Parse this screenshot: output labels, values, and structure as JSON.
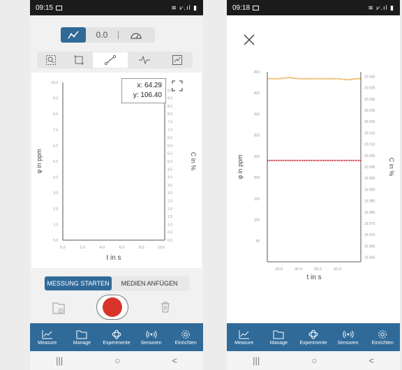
{
  "colors": {
    "accent": "#2f6a99",
    "record": "#d9342b",
    "series_orange": "#e39d2c",
    "series_red": "#c8232c"
  },
  "left": {
    "status": {
      "time": "09:15",
      "icons": "≋ ⩗.ıl ▮"
    },
    "mode_bar": {
      "graph_icon": "graph-icon",
      "value_label": "0.0",
      "gauge_icon": "gauge-icon"
    },
    "toolbar": [
      "zoom-box-icon",
      "crop-icon",
      "line-tool-icon",
      "smoothing-icon",
      "fit-icon"
    ],
    "chart_data": {
      "type": "line",
      "xlabel": "t in s",
      "ylabel": "φ in ppm",
      "y2label": "C in %",
      "xlim": [
        0,
        100
      ],
      "ylim": [
        0,
        10
      ],
      "y2lim": [
        0,
        10
      ],
      "xticks": [
        "0.0",
        "2.0",
        "4.0",
        "6.0",
        "8.0",
        "10.0"
      ],
      "yticks": [
        "0.0",
        "1.0",
        "2.0",
        "3.0",
        "4.0",
        "5.0",
        "6.0",
        "7.0",
        "8.0",
        "9.0",
        "10.0"
      ],
      "y2ticks": [
        "0.0",
        "0.5",
        "1.0",
        "1.5",
        "2.0",
        "2.5",
        "3.0",
        "3.5",
        "4.0",
        "4.5",
        "5.0",
        "5.5",
        "6.0",
        "6.5",
        "7.0",
        "7.5",
        "8.0",
        "8.5",
        "9.0",
        "9.5"
      ],
      "series": [],
      "grid": false
    },
    "readout": {
      "x": "x: 64.29",
      "y": "y: 106.40"
    },
    "buttons": {
      "start": "MESSUNG STARTEN",
      "media": "MEDIEN ANFÜGEN"
    }
  },
  "right": {
    "status": {
      "time": "09:18",
      "icons": "≋ ⩗.ıl ▮"
    },
    "chart_data": {
      "type": "line",
      "xlabel": "t in s",
      "ylabel": "φ in ppm",
      "y2label": "C in %",
      "xlim": [
        24,
        72
      ],
      "ylim": [
        0,
        450
      ],
      "y2lim": [
        19.958,
        20.042
      ],
      "xticks": [
        "30.0",
        "40.0",
        "50.0",
        "60.0"
      ],
      "xtick_values": [
        30,
        40,
        50,
        60
      ],
      "yticks": [
        "50",
        "100",
        "150",
        "200",
        "250",
        "300",
        "350",
        "400",
        "450"
      ],
      "y2ticks": [
        "19.960",
        "19.965",
        "19.970",
        "19.975",
        "19.980",
        "19.985",
        "19.990",
        "19.995",
        "20.000",
        "20.005",
        "20.010",
        "20.015",
        "20.020",
        "20.025",
        "20.030",
        "20.035",
        "20.040"
      ],
      "series": [
        {
          "axis": "y2",
          "x": [
            24,
            30,
            35,
            40,
            45,
            50,
            55,
            60,
            65,
            70,
            72
          ],
          "values": [
            20.039,
            20.039,
            20.0395,
            20.039,
            20.039,
            20.039,
            20.039,
            20.039,
            20.0385,
            20.039,
            20.039
          ]
        },
        {
          "axis": "y",
          "x": [
            24,
            30,
            35,
            40,
            45,
            50,
            55,
            60,
            65,
            70,
            72
          ],
          "values": [
            240,
            240,
            240,
            240,
            240,
            240,
            240,
            240,
            240,
            240,
            240
          ]
        }
      ],
      "grid": false
    }
  },
  "nav": [
    {
      "label": "Measure",
      "icon": "measure-icon"
    },
    {
      "label": "Manage",
      "icon": "folder-icon"
    },
    {
      "label": "Experimente",
      "icon": "experiment-icon"
    },
    {
      "label": "Sensoren",
      "icon": "sensor-icon"
    },
    {
      "label": "Einrichten",
      "icon": "gear-icon"
    }
  ],
  "sysnav": {
    "recents": "|||",
    "home": "○",
    "back": "<"
  }
}
